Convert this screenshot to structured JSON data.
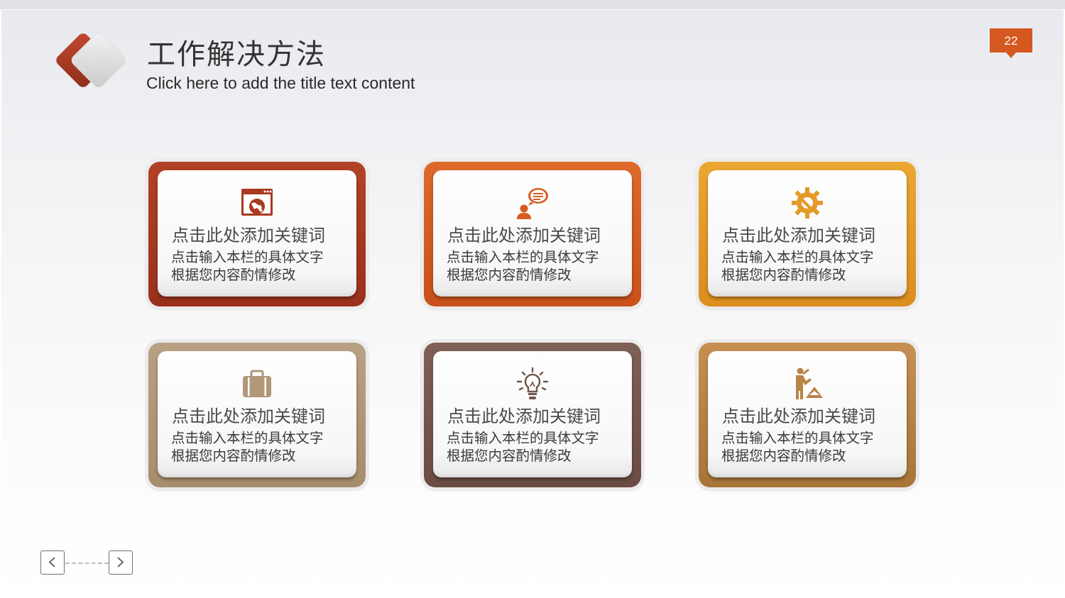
{
  "header": {
    "title": "工作解决方法",
    "subtitle": "Click here to add the title text content",
    "page_number": "22",
    "accent_color": "#d4581f"
  },
  "cards": [
    {
      "icon": "web-browser-icon",
      "color": "#a9391f",
      "keyword": "点击此处添加关键词",
      "line1": "点击输入本栏的具体文字",
      "line2": "根据您内容酌情修改"
    },
    {
      "icon": "chat-user-icon",
      "color": "#d65d22",
      "keyword": "点击此处添加关键词",
      "line1": "点击输入本栏的具体文字",
      "line2": "根据您内容酌情修改"
    },
    {
      "icon": "gear-wrench-icon",
      "color": "#e49a26",
      "keyword": "点击此处添加关键词",
      "line1": "点击输入本栏的具体文字",
      "line2": "根据您内容酌情修改"
    },
    {
      "icon": "briefcase-icon",
      "color": "#b09878",
      "keyword": "点击此处添加关键词",
      "line1": "点击输入本栏的具体文字",
      "line2": "根据您内容酌情修改"
    },
    {
      "icon": "lightbulb-icon",
      "color": "#75574d",
      "keyword": "点击此处添加关键词",
      "line1": "点击输入本栏的具体文字",
      "line2": "根据您内容酌情修改"
    },
    {
      "icon": "worker-icon",
      "color": "#b98447",
      "keyword": "点击此处添加关键词",
      "line1": "点击输入本栏的具体文字",
      "line2": "根据您内容酌情修改"
    }
  ],
  "nav": {
    "prev_icon": "chevron-left-icon",
    "next_icon": "chevron-right-icon"
  }
}
